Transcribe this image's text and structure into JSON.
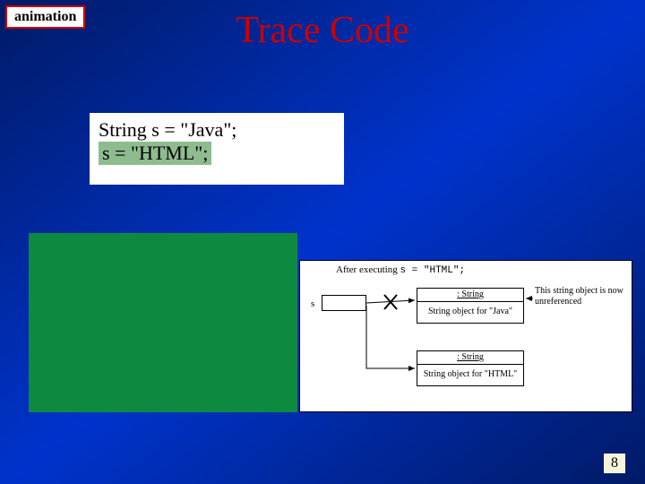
{
  "label": "animation",
  "title": "Trace Code",
  "code": {
    "line1": "String s = \"Java\";",
    "line2": "s = \"HTML\";"
  },
  "diagram": {
    "afterText": "After executing ",
    "afterCode": "s = \"HTML\";",
    "varName": "s",
    "obj1": {
      "type": ": String",
      "value": "String object for \"Java\""
    },
    "obj2": {
      "type": ": String",
      "value": "String object for \"HTML\""
    },
    "annotation": "This string object is now unreferenced"
  },
  "pageNumber": "8"
}
